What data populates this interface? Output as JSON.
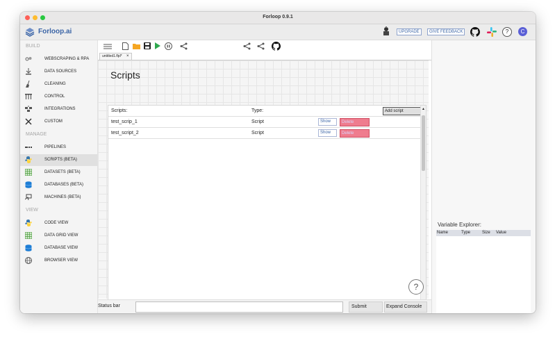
{
  "window": {
    "title": "Forloop 0.9.1"
  },
  "colors": {
    "accent": "#3a64a6",
    "delete": "#ef7c8e",
    "traffic": [
      "#fe5f57",
      "#febc2e",
      "#28c840"
    ]
  },
  "header": {
    "brand": "Forloop.ai",
    "upgrade_label": "UPGRADE",
    "feedback_label": "GIVE FEEDBACK",
    "help_label": "?",
    "avatar_letter": "C"
  },
  "sidebar": {
    "build_label": "BUILD",
    "manage_label": "MANAGE",
    "view_label": "VIEW",
    "build": [
      {
        "label": "WEBSCRAPING & RPA",
        "icon": "webscraping-icon"
      },
      {
        "label": "DATA SOURCES",
        "icon": "data-sources-icon"
      },
      {
        "label": "CLEANING",
        "icon": "broom-icon"
      },
      {
        "label": "CONTROL",
        "icon": "control-icon"
      },
      {
        "label": "INTEGRATIONS",
        "icon": "integrations-icon"
      },
      {
        "label": "CUSTOM",
        "icon": "custom-icon"
      }
    ],
    "manage": [
      {
        "label": "PIPELINES",
        "icon": "pipelines-icon"
      },
      {
        "label": "SCRIPTS (BETA)",
        "icon": "python-icon"
      },
      {
        "label": "DATASETS (BETA)",
        "icon": "grid-icon"
      },
      {
        "label": "DATABASES (BETA)",
        "icon": "database-icon"
      },
      {
        "label": "MACHINES (BETA)",
        "icon": "machine-icon"
      }
    ],
    "view": [
      {
        "label": "CODE VIEW",
        "icon": "python-icon"
      },
      {
        "label": "DATA GRID VIEW",
        "icon": "grid-icon"
      },
      {
        "label": "DATABASE VIEW",
        "icon": "database-icon"
      },
      {
        "label": "BROWSER VIEW",
        "icon": "globe-icon"
      }
    ]
  },
  "tab": {
    "label": "untitled1.flpl*",
    "close": "×"
  },
  "scripts": {
    "heading": "Scripts",
    "col_scripts": "Scripts:",
    "col_type": "Type:",
    "add_label": "Add script",
    "rows": [
      {
        "name": "test_scrip_1",
        "type": "Script",
        "show": "Show",
        "delete": "Delete"
      },
      {
        "name": "test_script_2",
        "type": "Script",
        "show": "Show",
        "delete": "Delete"
      }
    ]
  },
  "help_button": "?",
  "status": {
    "label": "Status bar",
    "submit": "Submit",
    "expand": "Expand Console"
  },
  "explorer": {
    "title": "Variable Explorer:",
    "cols": [
      "Name",
      "Type",
      "Size",
      "Value"
    ]
  }
}
